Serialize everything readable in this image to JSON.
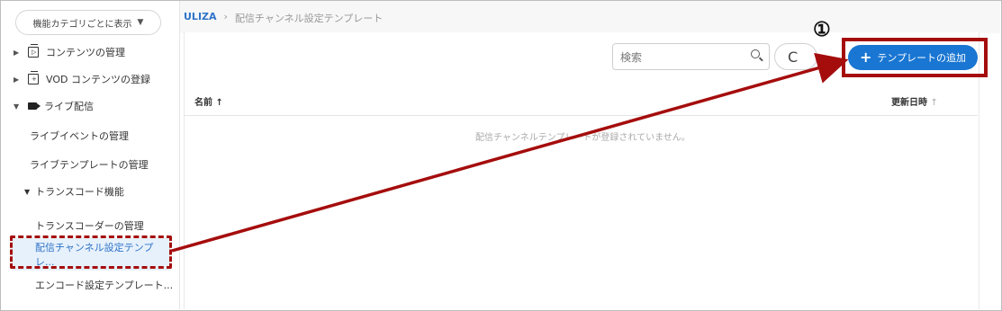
{
  "sidebar": {
    "category_button": "機能カテゴリごとに表示",
    "items": [
      {
        "label": "コンテンツの管理"
      },
      {
        "label": "VOD コンテンツの登録"
      },
      {
        "label": "ライブ配信"
      },
      {
        "label": "ライブイベントの管理"
      },
      {
        "label": "ライブテンプレートの管理"
      },
      {
        "label": "トランスコード機能"
      },
      {
        "label": "トランスコーダーの管理"
      },
      {
        "label": "配信チャンネル設定テンプレ..."
      },
      {
        "label": "エンコード設定テンプレート..."
      }
    ]
  },
  "breadcrumb": {
    "root": "ULIZA",
    "sep": "›",
    "current": "配信チャンネル設定テンプレート"
  },
  "toolbar": {
    "search_placeholder": "検索",
    "reload_glyph": "C",
    "add_label": "テンプレートの追加"
  },
  "table": {
    "col_name": "名前",
    "col_updated": "更新日時",
    "empty": "配信チャンネルテンプレートが登録されていません。"
  },
  "annotation": {
    "step": "①"
  },
  "colors": {
    "accent": "#1976d2",
    "highlight_red": "#a50d0d",
    "active_bg": "#e7f1fc"
  }
}
